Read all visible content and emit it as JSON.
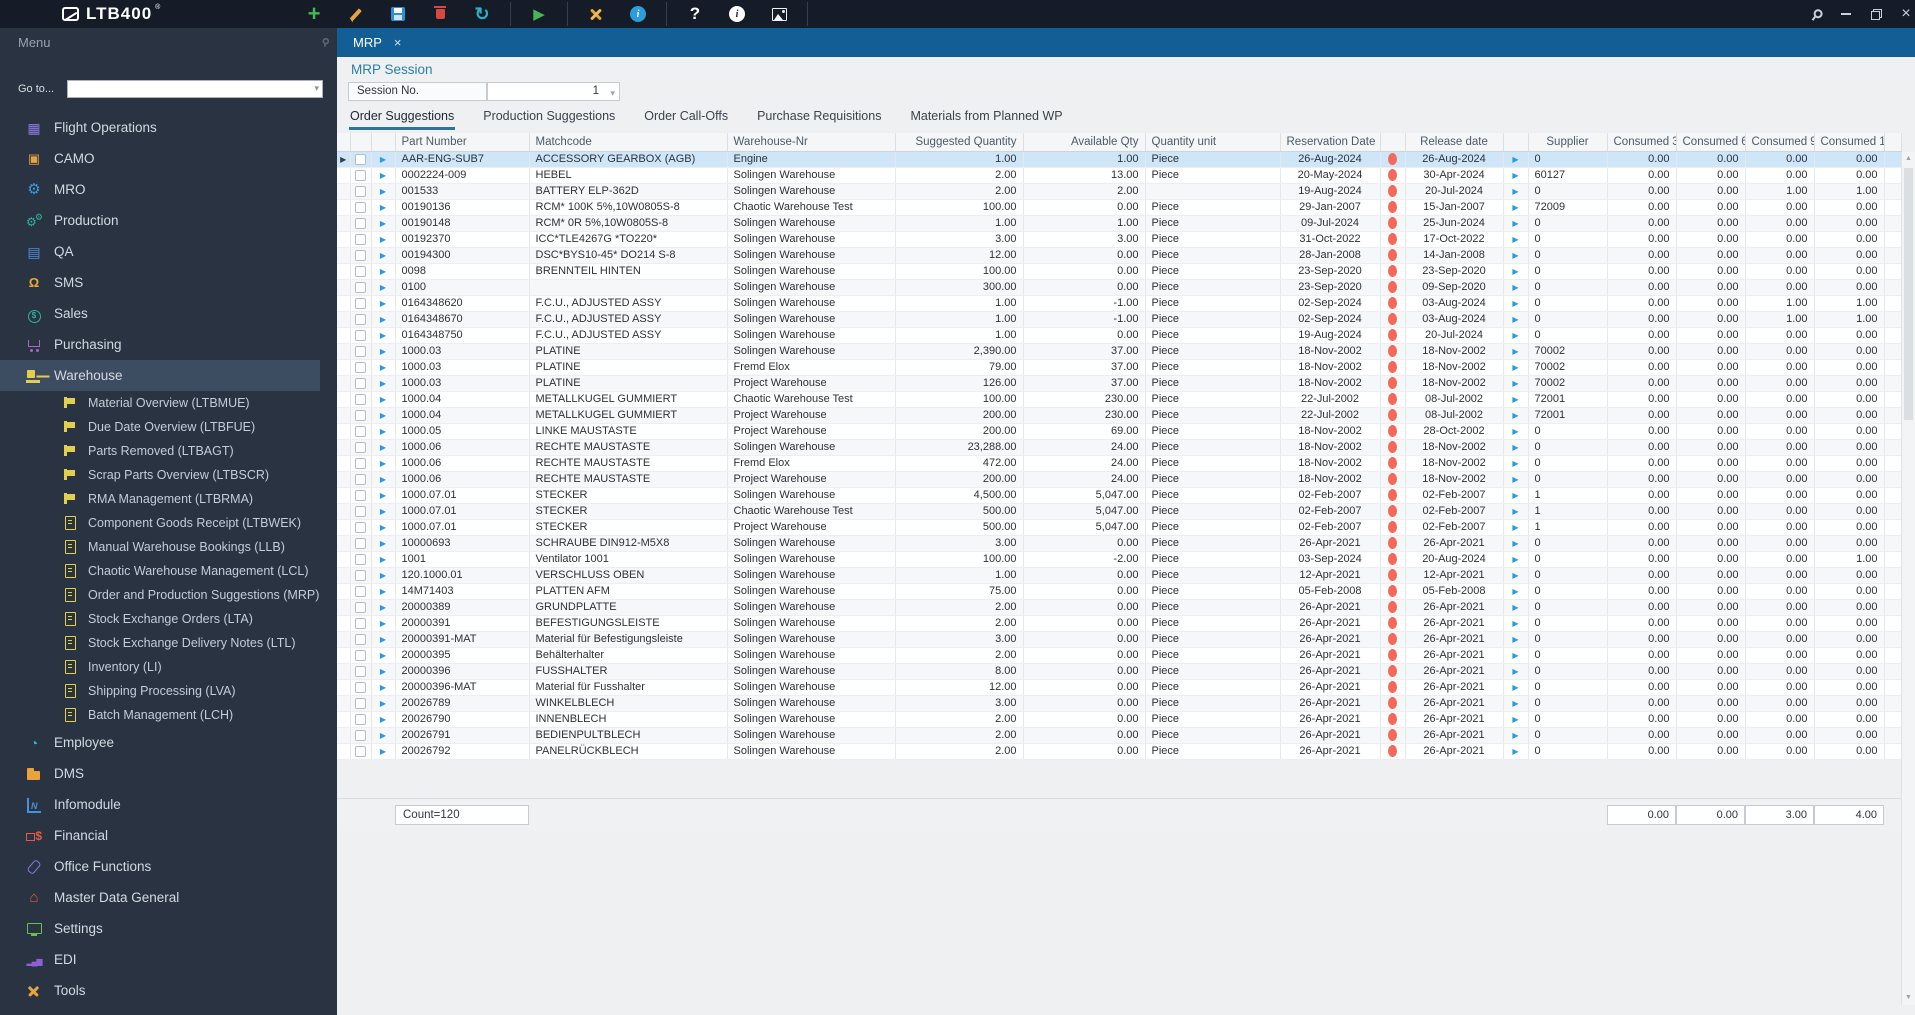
{
  "toolbar": {
    "logo": "LTB400",
    "buttons": [
      "add",
      "edit",
      "save",
      "delete",
      "refresh",
      "run",
      "tools",
      "info",
      "help",
      "about",
      "image"
    ],
    "window_controls": [
      "pin",
      "minimize",
      "restore",
      "close"
    ]
  },
  "tabbar": {
    "active_document_tab": "MRP"
  },
  "sidebar": {
    "title": "Menu",
    "goto_label": "Go to...",
    "goto_value": "",
    "items": [
      {
        "label": "Flight Operations",
        "icon": "calendar",
        "color": "#8d7ae6"
      },
      {
        "label": "CAMO",
        "icon": "tags",
        "color": "#e8a33d"
      },
      {
        "label": "MRO",
        "icon": "gear",
        "color": "#3b9ad9"
      },
      {
        "label": "Production",
        "icon": "gears",
        "color": "#2ab5a5"
      },
      {
        "label": "QA",
        "icon": "tray",
        "color": "#4a90d9"
      },
      {
        "label": "SMS",
        "icon": "bell",
        "color": "#f0a830"
      },
      {
        "label": "Sales",
        "icon": "coin",
        "color": "#2bb5a0"
      },
      {
        "label": "Purchasing",
        "icon": "cart",
        "color": "#a569c4"
      },
      {
        "label": "Warehouse",
        "icon": "forklift",
        "color": "#e3cf4e",
        "selected": true,
        "children": [
          {
            "label": "Material Overview (LTBMUE)",
            "icon": "flag"
          },
          {
            "label": "Due Date Overview (LTBFUE)",
            "icon": "flag"
          },
          {
            "label": "Parts Removed (LTBAGT)",
            "icon": "flag"
          },
          {
            "label": "Scrap Parts Overview (LTBSCR)",
            "icon": "flag"
          },
          {
            "label": "RMA Management (LTBRMA)",
            "icon": "flag"
          },
          {
            "label": "Component Goods Receipt (LTBWEK)",
            "icon": "doc"
          },
          {
            "label": "Manual Warehouse Bookings (LLB)",
            "icon": "doc"
          },
          {
            "label": "Chaotic Warehouse Management (LCL)",
            "icon": "doc"
          },
          {
            "label": "Order and Production Suggestions (MRP)",
            "icon": "doc"
          },
          {
            "label": "Stock Exchange Orders (LTA)",
            "icon": "doc"
          },
          {
            "label": "Stock Exchange Delivery Notes (LTL)",
            "icon": "doc"
          },
          {
            "label": "Inventory (LI)",
            "icon": "doc"
          },
          {
            "label": "Shipping Processing (LVA)",
            "icon": "doc"
          },
          {
            "label": "Batch Management (LCH)",
            "icon": "doc"
          }
        ]
      },
      {
        "label": "Employee",
        "icon": "clock",
        "color": "#29b6c8"
      },
      {
        "label": "DMS",
        "icon": "folder",
        "color": "#e8a33d"
      },
      {
        "label": "Infomodule",
        "icon": "graph",
        "color": "#4a90d9"
      },
      {
        "label": "Financial",
        "icon": "cash",
        "color": "#e05d44"
      },
      {
        "label": "Office Functions",
        "icon": "clip",
        "color": "#8d7ae6"
      },
      {
        "label": "Master Data General",
        "icon": "home",
        "color": "#e05d44"
      },
      {
        "label": "Settings",
        "icon": "monitor",
        "color": "#6abf4b"
      },
      {
        "label": "EDI",
        "icon": "bars",
        "color": "#8d5fd3"
      },
      {
        "label": "Tools",
        "icon": "xtools",
        "color": "#e8a33d"
      }
    ]
  },
  "main": {
    "session_title": "MRP Session",
    "session_no_label": "Session No.",
    "session_no_value": "1",
    "tabs": [
      "Order Suggestions",
      "Production Suggestions",
      "Order Call-Offs",
      "Purchase Requisitions",
      "Materials from Planned WP"
    ],
    "active_tab": 0,
    "table": {
      "columns": [
        "",
        "",
        "",
        "Part Number",
        "Matchcode",
        "Warehouse-Nr",
        "Suggested Quantity",
        "Available Qty",
        "Quantity unit",
        "Reservation Date",
        "",
        "Release date",
        "",
        "Supplier",
        "Consumed 3",
        "Consumed 6",
        "Consumed 9",
        "Consumed 1",
        ""
      ],
      "selected_row": 0,
      "rows": [
        [
          "AAR-ENG-SUB7",
          "ACCESSORY GEARBOX (AGB)",
          "Engine",
          "1.00",
          "1.00",
          "Piece",
          "26-Aug-2024",
          "26-Aug-2024",
          "0",
          "0.00",
          "0.00",
          "0.00",
          "0.00"
        ],
        [
          "0002224-009",
          "HEBEL",
          "Solingen Warehouse",
          "2.00",
          "13.00",
          "Piece",
          "20-May-2024",
          "30-Apr-2024",
          "60127",
          "0.00",
          "0.00",
          "0.00",
          "0.00"
        ],
        [
          "001533",
          "BATTERY ELP-362D",
          "Solingen Warehouse",
          "2.00",
          "2.00",
          "",
          "19-Aug-2024",
          "20-Jul-2024",
          "0",
          "0.00",
          "0.00",
          "1.00",
          "1.00"
        ],
        [
          "00190136",
          "RCM* 100K 5%,10W0805S-8",
          "Chaotic Warehouse Test",
          "100.00",
          "0.00",
          "Piece",
          "29-Jan-2007",
          "15-Jan-2007",
          "72009",
          "0.00",
          "0.00",
          "0.00",
          "0.00"
        ],
        [
          "00190148",
          "RCM*  0R 5%,10W0805S-8",
          "Solingen Warehouse",
          "1.00",
          "1.00",
          "Piece",
          "09-Jul-2024",
          "25-Jun-2024",
          "0",
          "0.00",
          "0.00",
          "0.00",
          "0.00"
        ],
        [
          "00192370",
          "ICC*TLE4267G *TO220*",
          "Solingen Warehouse",
          "3.00",
          "3.00",
          "Piece",
          "31-Oct-2022",
          "17-Oct-2022",
          "0",
          "0.00",
          "0.00",
          "0.00",
          "0.00"
        ],
        [
          "00194300",
          "DSC*BYS10-45* DO214 S-8",
          "Solingen Warehouse",
          "12.00",
          "0.00",
          "Piece",
          "28-Jan-2008",
          "14-Jan-2008",
          "0",
          "0.00",
          "0.00",
          "0.00",
          "0.00"
        ],
        [
          "0098",
          "BRENNTEIL HINTEN",
          "Solingen Warehouse",
          "100.00",
          "0.00",
          "Piece",
          "23-Sep-2020",
          "23-Sep-2020",
          "0",
          "0.00",
          "0.00",
          "0.00",
          "0.00"
        ],
        [
          "0100",
          "",
          "Solingen Warehouse",
          "300.00",
          "0.00",
          "Piece",
          "23-Sep-2020",
          "09-Sep-2020",
          "0",
          "0.00",
          "0.00",
          "0.00",
          "0.00"
        ],
        [
          "0164348620",
          "F.C.U., ADJUSTED ASSY",
          "Solingen Warehouse",
          "1.00",
          "-1.00",
          "Piece",
          "02-Sep-2024",
          "03-Aug-2024",
          "0",
          "0.00",
          "0.00",
          "1.00",
          "1.00"
        ],
        [
          "0164348670",
          "F.C.U., ADJUSTED ASSY",
          "Solingen Warehouse",
          "1.00",
          "-1.00",
          "Piece",
          "02-Sep-2024",
          "03-Aug-2024",
          "0",
          "0.00",
          "0.00",
          "1.00",
          "1.00"
        ],
        [
          "0164348750",
          "F.C.U., ADJUSTED ASSY",
          "Solingen Warehouse",
          "1.00",
          "0.00",
          "Piece",
          "19-Aug-2024",
          "20-Jul-2024",
          "0",
          "0.00",
          "0.00",
          "0.00",
          "0.00"
        ],
        [
          "1000.03",
          "PLATINE",
          "Solingen Warehouse",
          "2,390.00",
          "37.00",
          "Piece",
          "18-Nov-2002",
          "18-Nov-2002",
          "70002",
          "0.00",
          "0.00",
          "0.00",
          "0.00"
        ],
        [
          "1000.03",
          "PLATINE",
          "Fremd Elox",
          "79.00",
          "37.00",
          "Piece",
          "18-Nov-2002",
          "18-Nov-2002",
          "70002",
          "0.00",
          "0.00",
          "0.00",
          "0.00"
        ],
        [
          "1000.03",
          "PLATINE",
          "Project Warehouse",
          "126.00",
          "37.00",
          "Piece",
          "18-Nov-2002",
          "18-Nov-2002",
          "70002",
          "0.00",
          "0.00",
          "0.00",
          "0.00"
        ],
        [
          "1000.04",
          "METALLKUGEL GUMMIERT",
          "Chaotic Warehouse Test",
          "100.00",
          "230.00",
          "Piece",
          "22-Jul-2002",
          "08-Jul-2002",
          "72001",
          "0.00",
          "0.00",
          "0.00",
          "0.00"
        ],
        [
          "1000.04",
          "METALLKUGEL GUMMIERT",
          "Project Warehouse",
          "200.00",
          "230.00",
          "Piece",
          "22-Jul-2002",
          "08-Jul-2002",
          "72001",
          "0.00",
          "0.00",
          "0.00",
          "0.00"
        ],
        [
          "1000.05",
          "LINKE MAUSTASTE",
          "Project Warehouse",
          "200.00",
          "69.00",
          "Piece",
          "18-Nov-2002",
          "28-Oct-2002",
          "0",
          "0.00",
          "0.00",
          "0.00",
          "0.00"
        ],
        [
          "1000.06",
          "RECHTE MAUSTASTE",
          "Solingen Warehouse",
          "23,288.00",
          "24.00",
          "Piece",
          "18-Nov-2002",
          "18-Nov-2002",
          "0",
          "0.00",
          "0.00",
          "0.00",
          "0.00"
        ],
        [
          "1000.06",
          "RECHTE MAUSTASTE",
          "Fremd Elox",
          "472.00",
          "24.00",
          "Piece",
          "18-Nov-2002",
          "18-Nov-2002",
          "0",
          "0.00",
          "0.00",
          "0.00",
          "0.00"
        ],
        [
          "1000.06",
          "RECHTE MAUSTASTE",
          "Project Warehouse",
          "200.00",
          "24.00",
          "Piece",
          "18-Nov-2002",
          "18-Nov-2002",
          "0",
          "0.00",
          "0.00",
          "0.00",
          "0.00"
        ],
        [
          "1000.07.01",
          "STECKER",
          "Solingen Warehouse",
          "4,500.00",
          "5,047.00",
          "Piece",
          "02-Feb-2007",
          "02-Feb-2007",
          "1",
          "0.00",
          "0.00",
          "0.00",
          "0.00"
        ],
        [
          "1000.07.01",
          "STECKER",
          "Chaotic Warehouse Test",
          "500.00",
          "5,047.00",
          "Piece",
          "02-Feb-2007",
          "02-Feb-2007",
          "1",
          "0.00",
          "0.00",
          "0.00",
          "0.00"
        ],
        [
          "1000.07.01",
          "STECKER",
          "Project Warehouse",
          "500.00",
          "5,047.00",
          "Piece",
          "02-Feb-2007",
          "02-Feb-2007",
          "1",
          "0.00",
          "0.00",
          "0.00",
          "0.00"
        ],
        [
          "10000693",
          "SCHRAUBE DIN912-M5X8",
          "Solingen Warehouse",
          "3.00",
          "0.00",
          "Piece",
          "26-Apr-2021",
          "26-Apr-2021",
          "0",
          "0.00",
          "0.00",
          "0.00",
          "0.00"
        ],
        [
          "1001",
          "Ventilator 1001",
          "Solingen Warehouse",
          "100.00",
          "-2.00",
          "Piece",
          "03-Sep-2024",
          "20-Aug-2024",
          "0",
          "0.00",
          "0.00",
          "0.00",
          "1.00"
        ],
        [
          "120.1000.01",
          "VERSCHLUSS OBEN",
          "Solingen Warehouse",
          "1.00",
          "0.00",
          "Piece",
          "12-Apr-2021",
          "12-Apr-2021",
          "0",
          "0.00",
          "0.00",
          "0.00",
          "0.00"
        ],
        [
          "14M71403",
          "PLATTEN AFM",
          "Solingen Warehouse",
          "75.00",
          "0.00",
          "Piece",
          "05-Feb-2008",
          "05-Feb-2008",
          "0",
          "0.00",
          "0.00",
          "0.00",
          "0.00"
        ],
        [
          "20000389",
          "GRUNDPLATTE",
          "Solingen Warehouse",
          "2.00",
          "0.00",
          "Piece",
          "26-Apr-2021",
          "26-Apr-2021",
          "0",
          "0.00",
          "0.00",
          "0.00",
          "0.00"
        ],
        [
          "20000391",
          "BEFESTIGUNGSLEISTE",
          "Solingen Warehouse",
          "2.00",
          "0.00",
          "Piece",
          "26-Apr-2021",
          "26-Apr-2021",
          "0",
          "0.00",
          "0.00",
          "0.00",
          "0.00"
        ],
        [
          "20000391-MAT",
          "Material für Befestigungsleiste",
          "Solingen Warehouse",
          "3.00",
          "0.00",
          "Piece",
          "26-Apr-2021",
          "26-Apr-2021",
          "0",
          "0.00",
          "0.00",
          "0.00",
          "0.00"
        ],
        [
          "20000395",
          "Behälterhalter",
          "Solingen Warehouse",
          "2.00",
          "0.00",
          "Piece",
          "26-Apr-2021",
          "26-Apr-2021",
          "0",
          "0.00",
          "0.00",
          "0.00",
          "0.00"
        ],
        [
          "20000396",
          "FUSSHALTER",
          "Solingen Warehouse",
          "8.00",
          "0.00",
          "Piece",
          "26-Apr-2021",
          "26-Apr-2021",
          "0",
          "0.00",
          "0.00",
          "0.00",
          "0.00"
        ],
        [
          "20000396-MAT",
          "Material für Fusshalter",
          "Solingen Warehouse",
          "12.00",
          "0.00",
          "Piece",
          "26-Apr-2021",
          "26-Apr-2021",
          "0",
          "0.00",
          "0.00",
          "0.00",
          "0.00"
        ],
        [
          "20026789",
          "WINKELBLECH",
          "Solingen Warehouse",
          "3.00",
          "0.00",
          "Piece",
          "26-Apr-2021",
          "26-Apr-2021",
          "0",
          "0.00",
          "0.00",
          "0.00",
          "0.00"
        ],
        [
          "20026790",
          "INNENBLECH",
          "Solingen Warehouse",
          "2.00",
          "0.00",
          "Piece",
          "26-Apr-2021",
          "26-Apr-2021",
          "0",
          "0.00",
          "0.00",
          "0.00",
          "0.00"
        ],
        [
          "20026791",
          "BEDIENPULTBLECH",
          "Solingen Warehouse",
          "2.00",
          "0.00",
          "Piece",
          "26-Apr-2021",
          "26-Apr-2021",
          "0",
          "0.00",
          "0.00",
          "0.00",
          "0.00"
        ],
        [
          "20026792",
          "PANELRÜCKBLECH",
          "Solingen Warehouse",
          "2.00",
          "0.00",
          "Piece",
          "26-Apr-2021",
          "26-Apr-2021",
          "0",
          "0.00",
          "0.00",
          "0.00",
          "0.00"
        ]
      ],
      "footer": {
        "count": "Count=120",
        "totals": [
          "0.00",
          "0.00",
          "3.00",
          "4.00"
        ]
      }
    }
  },
  "colors": {
    "toolbar_bg": "#151c28",
    "sidebar_bg": "#2a3342",
    "tab_blue": "#135f95",
    "selection_blue": "#cfe5f8",
    "status_red": "#f4695c",
    "arrow_blue": "#2e9ae0",
    "sub_icon_yellow": "#e3cf4e",
    "active_tab_underline": "#2f7396"
  }
}
